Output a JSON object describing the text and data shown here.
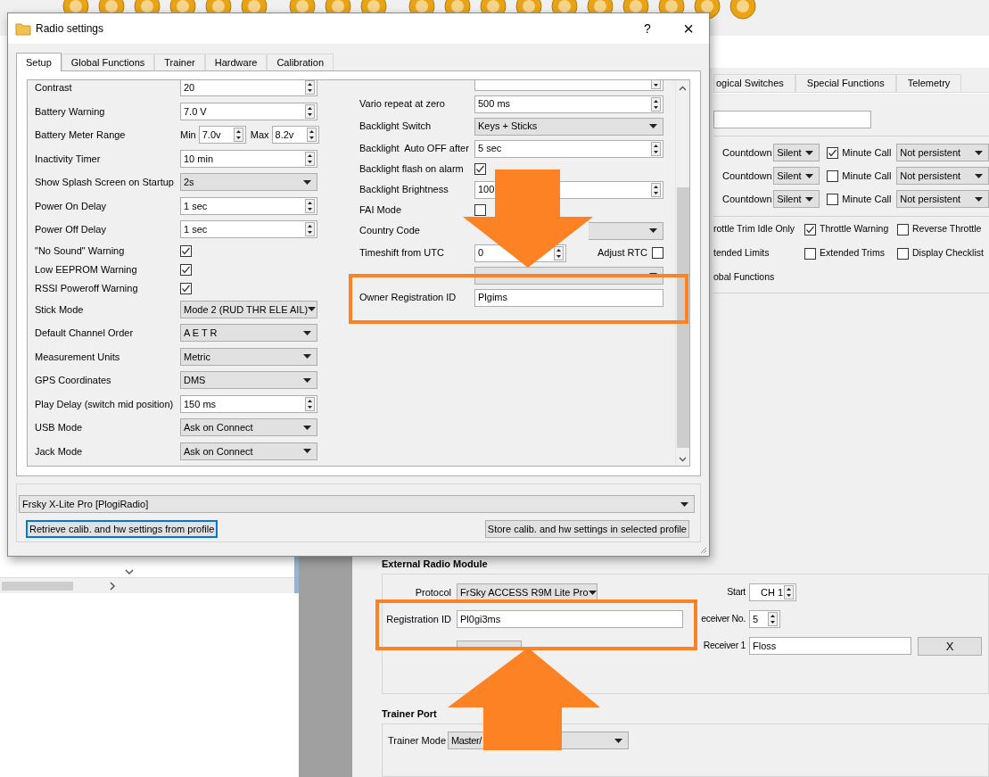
{
  "dialog": {
    "title": "Radio settings",
    "help": "?",
    "close": "×",
    "tabs": [
      {
        "label": "Setup",
        "selected": true
      },
      {
        "label": "Global Functions",
        "selected": false
      },
      {
        "label": "Trainer",
        "selected": false
      },
      {
        "label": "Hardware",
        "selected": false
      },
      {
        "label": "Calibration",
        "selected": false
      }
    ],
    "left_settings": [
      {
        "kind": "spin",
        "label": "Contrast",
        "value": "20"
      },
      {
        "kind": "spin",
        "label": "Battery Warning",
        "value": "7.0 V"
      },
      {
        "kind": "range",
        "label": "Battery Meter Range",
        "min_label": "Min",
        "min": "7.0v",
        "max_label": "Max",
        "max": "8.2v"
      },
      {
        "kind": "spin",
        "label": "Inactivity Timer",
        "value": "10 min"
      },
      {
        "kind": "combo",
        "label": "Show Splash Screen on Startup",
        "value": "2s"
      },
      {
        "kind": "spin",
        "label": "Power On Delay",
        "value": "1 sec"
      },
      {
        "kind": "spin",
        "label": "Power Off Delay",
        "value": "1 sec"
      },
      {
        "kind": "check",
        "label": "\"No Sound\" Warning",
        "checked": true
      },
      {
        "kind": "check",
        "label": "Low EEPROM Warning",
        "checked": true
      },
      {
        "kind": "check",
        "label": "RSSI Poweroff Warning",
        "checked": true
      },
      {
        "kind": "combo",
        "label": "Stick Mode",
        "value": "Mode 2 (RUD THR ELE AIL)"
      },
      {
        "kind": "combo",
        "label": "Default Channel Order",
        "value": "A E T R"
      },
      {
        "kind": "combo",
        "label": "Measurement Units",
        "value": "Metric"
      },
      {
        "kind": "combo",
        "label": "GPS Coordinates",
        "value": "DMS"
      },
      {
        "kind": "spin",
        "label": "Play Delay (switch mid position)",
        "value": "150 ms"
      },
      {
        "kind": "combo",
        "label": "USB Mode",
        "value": "Ask on Connect"
      },
      {
        "kind": "combo",
        "label": "Jack Mode",
        "value": "Ask on Connect"
      }
    ],
    "right_settings": [
      {
        "kind": "spin"
      },
      {
        "kind": "spin",
        "label": "Vario repeat at zero",
        "value": "500 ms"
      },
      {
        "kind": "combo",
        "label": "Backlight Switch",
        "value": "Keys + Sticks"
      },
      {
        "kind": "spin",
        "label": "Backlight  Auto OFF after",
        "value": "5 sec"
      },
      {
        "kind": "check",
        "label": "Backlight flash on alarm",
        "checked": true
      },
      {
        "kind": "spin",
        "label": "Backlight Brightness",
        "value": "100"
      },
      {
        "kind": "check",
        "label": "FAI Mode",
        "checked": false
      },
      {
        "kind": "combo",
        "label": "Country Code"
      },
      {
        "kind": "spin_check",
        "label": "Timeshift from UTC",
        "value": "0",
        "check_label": "Adjust RTC",
        "checked": false
      },
      {
        "kind": "combo"
      },
      {
        "kind": "text",
        "label": "Owner Registration ID",
        "value": "Plgims"
      }
    ],
    "profile": "Frsky X-Lite Pro [PlogiRadio]",
    "buttons": [
      {
        "label": "Retrieve calib. and hw settings from profile",
        "focused": true
      },
      {
        "label": "Store calib. and hw settings in selected profile",
        "focused": false
      }
    ]
  },
  "model_window": {
    "tabs": [
      {
        "label": "ogical Switches",
        "selected": false
      },
      {
        "label": "Special Functions",
        "selected": false
      },
      {
        "label": "Telemetry",
        "selected": false
      }
    ],
    "timers": [
      {
        "mode": "Countdown",
        "sound": "Silent",
        "minute_call_label": "Minute Call",
        "minute_call": true,
        "persistence": "Not persistent"
      },
      {
        "mode": "Countdown",
        "sound": "Silent",
        "minute_call_label": "Minute Call",
        "minute_call": false,
        "persistence": "Not persistent"
      },
      {
        "mode": "Countdown",
        "sound": "Silent",
        "minute_call_label": "Minute Call",
        "minute_call": false,
        "persistence": "Not persistent"
      }
    ],
    "options": [
      {
        "kind": "label",
        "label": "rottle Trim Idle Only"
      },
      {
        "kind": "check",
        "label": "Throttle Warning",
        "checked": true
      },
      {
        "kind": "check",
        "label": "Reverse Throttle",
        "checked": false
      },
      {
        "kind": "label",
        "label": "tended Limits"
      },
      {
        "kind": "check",
        "label": "Extended Trims",
        "checked": false
      },
      {
        "kind": "check",
        "label": "Display Checklist",
        "checked": false
      },
      {
        "kind": "label",
        "label": "obal Functions"
      }
    ],
    "external_module": {
      "title": "External Radio Module",
      "protocol_label": "Protocol",
      "protocol": "FrSky ACCESS R9M Lite Pro",
      "start_label": "Start",
      "start": "CH 1",
      "registration_label": "Registration ID",
      "registration": "Pl0gi3ms",
      "receiver_no_label": "eceiver No.",
      "receiver_no": "5",
      "receiver_label": "Receiver 1",
      "receiver": "Floss",
      "clear_button": "X"
    },
    "trainer_port": {
      "title": "Trainer Port",
      "mode_label": "Trainer Mode",
      "mode": "Master/"
    }
  }
}
